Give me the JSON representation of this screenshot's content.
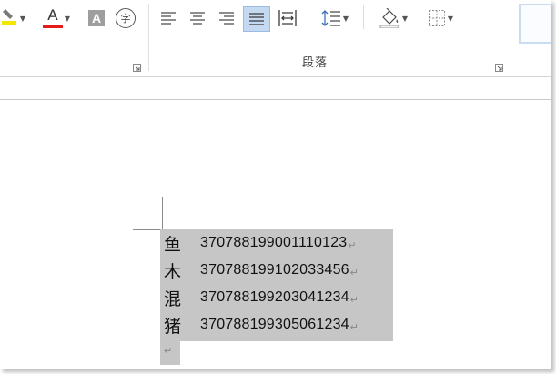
{
  "ribbon": {
    "group_label": "段落",
    "font_tools": {
      "font_color_letter": "A",
      "shading_letter": "A",
      "enclose_char": "字"
    },
    "colors": {
      "highlight_yellow": "#f5e600",
      "font_red": "#e31b1b",
      "selected_bg": "#c5d9f1"
    }
  },
  "document": {
    "lines": [
      {
        "name": "鱼",
        "number": "370788199001110123"
      },
      {
        "name": "木",
        "number": "370788199102033456"
      },
      {
        "name": "混",
        "number": "370788199203041234"
      },
      {
        "name": "猪",
        "number": "370788199305061234"
      }
    ],
    "paragraph_mark": "↵"
  }
}
